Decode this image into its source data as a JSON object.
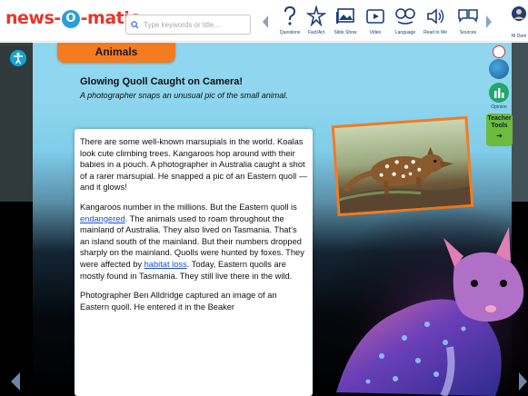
{
  "header": {
    "logo_text_left": "news-",
    "logo_text_mid": "O",
    "logo_text_right": "-matic",
    "search": {
      "placeholder": "Type keywords or title..."
    },
    "tools": [
      {
        "label": "Questions",
        "icon": "question-mark-icon"
      },
      {
        "label": "Fact/Act",
        "icon": "star-burst-icon"
      },
      {
        "label": "Slide Show",
        "icon": "image-icon"
      },
      {
        "label": "Video",
        "icon": "video-icon"
      },
      {
        "label": "Language",
        "icon": "language-icon"
      },
      {
        "label": "Read to Me",
        "icon": "speaker-icon"
      },
      {
        "label": "Sources",
        "icon": "sources-icon"
      }
    ],
    "user_label": "Hi Dem"
  },
  "article": {
    "section": "Animals",
    "headline": "Glowing Quoll Caught on Camera!",
    "subhead": "A photographer snaps an unusual pic of the small animal.",
    "p1": "There are some well-known marsupials in the world. Koalas look cute climbing trees. Kangaroos hop around with their babies in a pouch. A photographer in Australia caught a shot of a rarer marsupial. He snapped a pic of an Eastern quoll — and it glows!",
    "p2_a": "Kangaroos number in the millions. But the Eastern quoll is ",
    "p2_link1": "endangered",
    "p2_b": ". The animals used to roam throughout the mainland of Australia. They also lived on Tasmania. That’s an island south of the mainland. But their numbers dropped sharply on the mainland. Quolls were hunted by foxes. They were affected by ",
    "p2_link2": "habitat loss",
    "p2_c": ". Today, Eastern quolls are mostly found in Tasmania. They still live there in the wild.",
    "p3": "Photographer Ben Alldridge captured an image of an Eastern quoll. He entered it in the Beaker"
  },
  "sidebar": {
    "opinion_label": "Opinion",
    "teacher_line1": "Teacher",
    "teacher_line2": "Tools",
    "teacher_arrow": "➔"
  },
  "colors": {
    "accent_orange": "#f47b20",
    "brand_red": "#e8352b",
    "link_blue": "#1d4fd6",
    "teacher_green": "#6dbb3e"
  }
}
